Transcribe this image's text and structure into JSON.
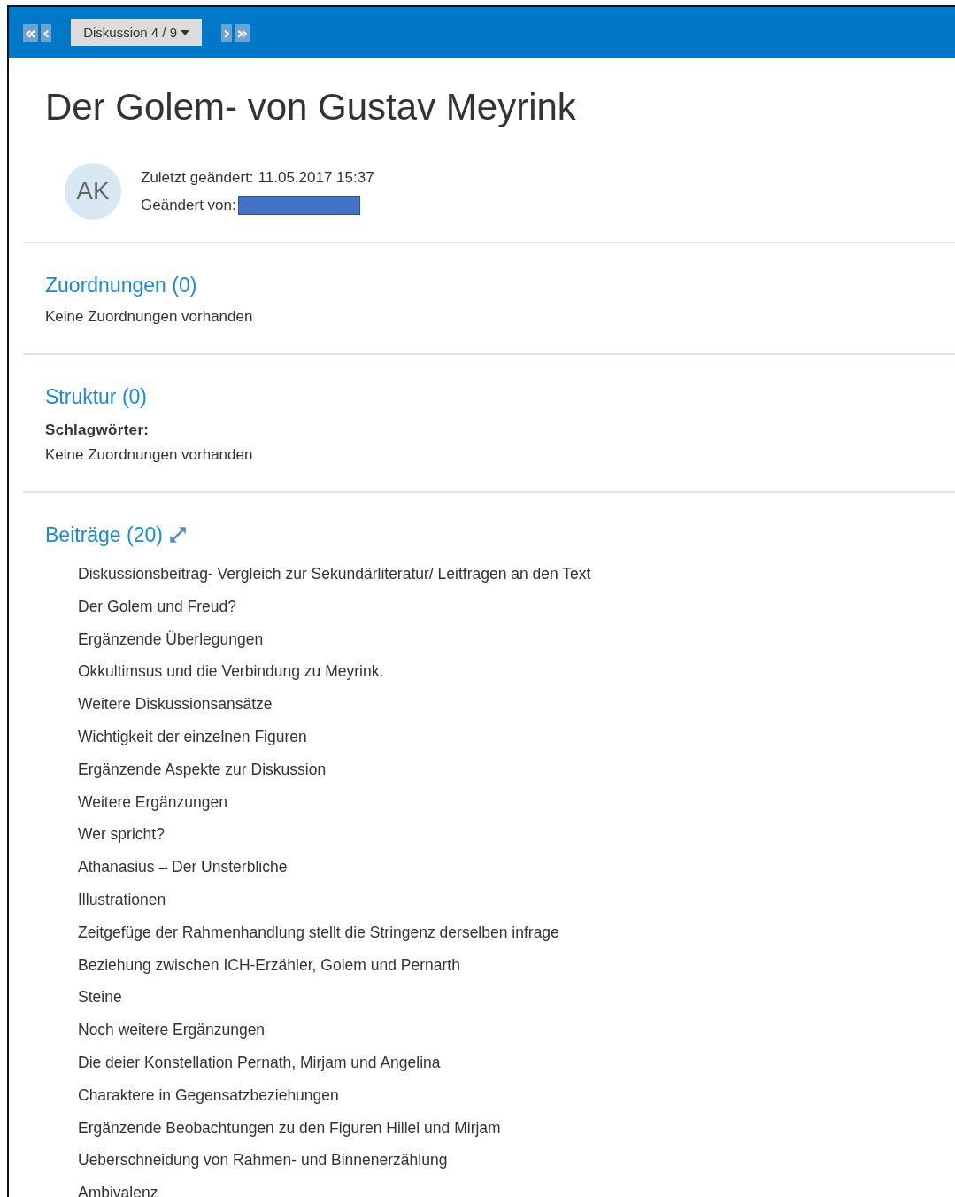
{
  "toolbar": {
    "first": "«",
    "prev": "‹",
    "dropdown": "Diskussion 4 / 9",
    "next": "›",
    "last": "»"
  },
  "title": "Der Golem- von Gustav Meyrink",
  "meta": {
    "avatar": "AK",
    "modified_label": "Zuletzt geändert:",
    "modified_value": "11.05.2017 15:37",
    "author_label": "Geändert von:",
    "author_redacted": true
  },
  "sections": [
    {
      "heading": "Zuordnungen (0)",
      "kind": "text",
      "text": "Keine Zuordnungen vorhanden"
    },
    {
      "heading": "Struktur (0)",
      "kind": "text",
      "label": "Schlagwörter:",
      "text": "Keine Zuordnungen vorhanden"
    },
    {
      "heading": "Beiträge (20)",
      "kind": "list",
      "expand_icon": true,
      "items": [
        "Diskussionsbeitrag- Vergleich zur Sekundärliteratur/ Leitfragen an den Text",
        "Der Golem und Freud?",
        "Ergänzende Überlegungen",
        "Okkultimsus und die Verbindung zu Meyrink.",
        "Weitere Diskussionsansätze",
        "Wichtigkeit der einzelnen Figuren",
        "Ergänzende Aspekte zur Diskussion",
        "Weitere Ergänzungen",
        "Wer spricht?",
        "Athanasius – Der Unsterbliche",
        "Illustrationen",
        "Zeitgefüge der Rahmenhandlung stellt die Stringenz derselben infrage",
        "Beziehung zwischen ICH-Erzähler, Golem und Pernarth",
        "Steine",
        "Noch weitere Ergänzungen",
        "Die deier Konstellation Pernath, Mirjam und Angelina",
        "Charaktere in Gegensatzbeziehungen",
        "Ergänzende Beobachtungen zu den Figuren Hillel und Mirjam",
        "Ueberschneidung von Rahmen- und Binnenerzählung",
        "Ambivalenz"
      ]
    }
  ]
}
